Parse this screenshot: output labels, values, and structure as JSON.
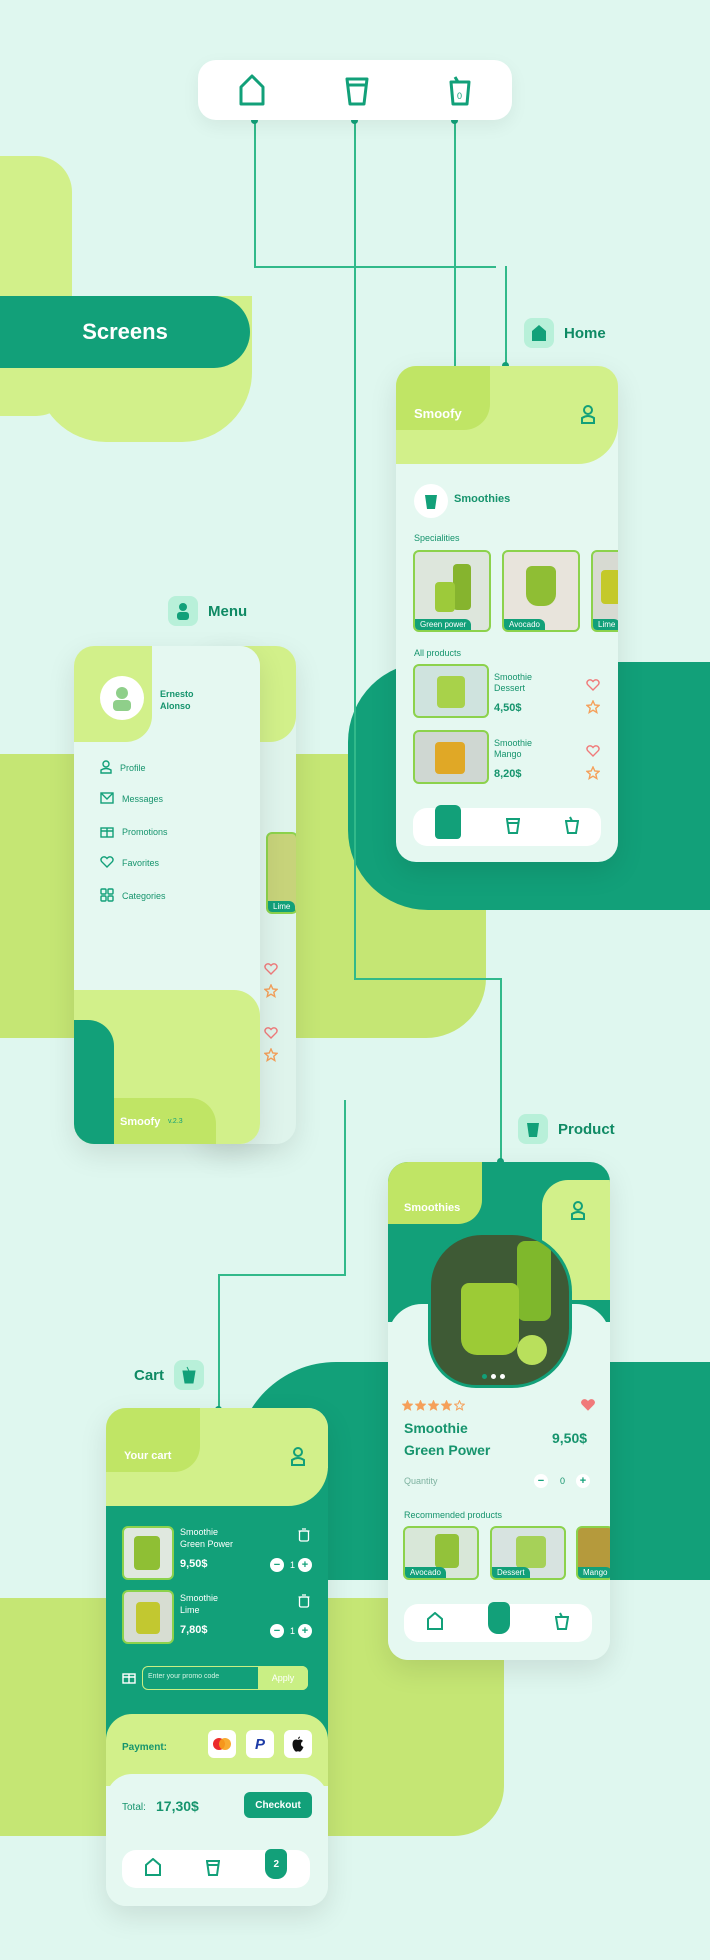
{
  "page": {
    "title": "Screens"
  },
  "labels": {
    "home": "Home",
    "menu": "Menu",
    "product": "Product",
    "cart": "Cart"
  },
  "home": {
    "brand": "Smoofy",
    "category": "Smoothies",
    "specialities_title": "Specialities",
    "specialities": [
      "Green power",
      "Avocado",
      "Lime"
    ],
    "all_products_title": "All products",
    "products": [
      {
        "name": "Smoothie Dessert",
        "price": "4,50$"
      },
      {
        "name": "Smoothie Mango",
        "price": "8,20$"
      }
    ]
  },
  "menu": {
    "user_name": "Ernesto Alonso",
    "items": [
      "Profile",
      "Messages",
      "Promotions",
      "Favorites",
      "Categories"
    ],
    "brand": "Smoofy",
    "version": "v.2.3",
    "peek_caption": "Lime"
  },
  "product": {
    "header_title": "Smoothies",
    "name_line1": "Smoothie",
    "name_line2": "Green Power",
    "price": "9,50$",
    "quantity_label": "Quantity",
    "quantity_value": "0",
    "rating": 4,
    "recommended_title": "Recommended products",
    "recommended": [
      "Avocado",
      "Dessert",
      "Mango"
    ]
  },
  "cart": {
    "title": "Your cart",
    "items": [
      {
        "name_line1": "Smoothie",
        "name_line2": "Green Power",
        "price": "9,50$",
        "qty": "1"
      },
      {
        "name_line1": "Smoothie",
        "name_line2": "Lime",
        "price": "7,80$",
        "qty": "1"
      }
    ],
    "promo_placeholder": "Enter your promo code",
    "apply_label": "Apply",
    "payment_label": "Payment:",
    "total_label": "Total:",
    "total_value": "17,30$",
    "checkout_label": "Checkout",
    "cart_badge": "2"
  },
  "colors": {
    "green": "#12a079",
    "light_green": "#d2f08a",
    "mint": "#dff7ef"
  }
}
